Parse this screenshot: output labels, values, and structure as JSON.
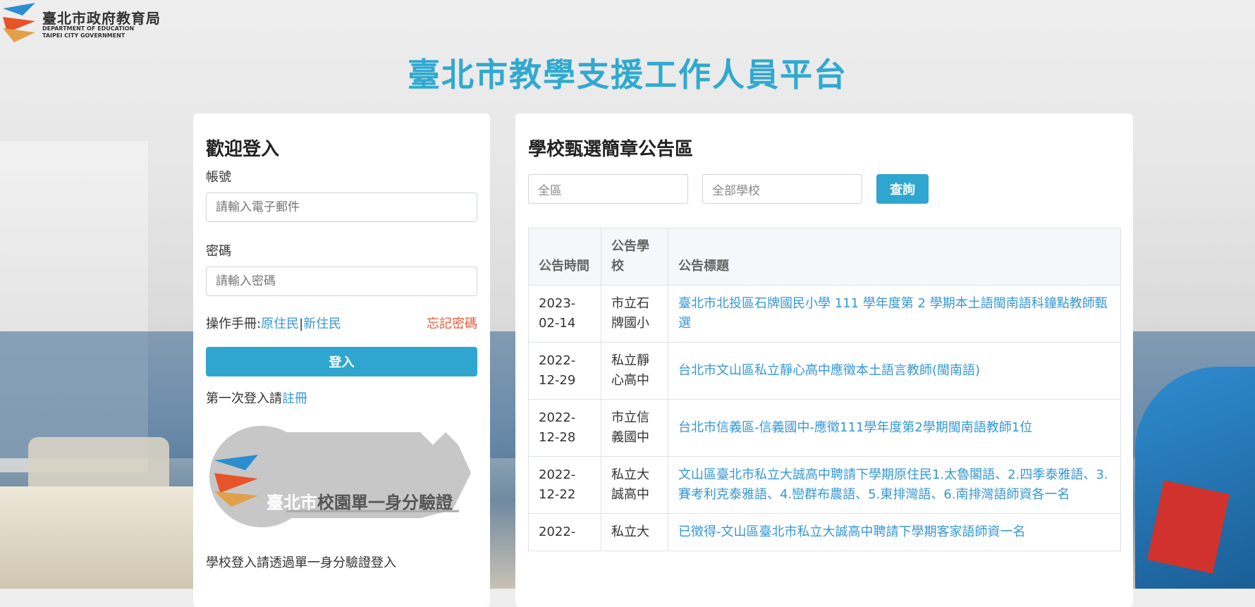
{
  "header": {
    "logo_cn": "臺北市政府教育局",
    "logo_en_line1": "DEPARTMENT OF EDUCATION",
    "logo_en_line2": "TAIPEI CITY GOVERNMENT",
    "site_title": "臺北市教學支援工作人員平台"
  },
  "login": {
    "heading": "歡迎登入",
    "account_label": "帳號",
    "account_placeholder": "請輸入電子郵件",
    "password_label": "密碼",
    "password_placeholder": "請輸入密碼",
    "manual_prefix": "操作手冊:",
    "manual_link1": "原住民",
    "manual_sep": "|",
    "manual_link2": "新住民",
    "forgot_password": "忘記密碼",
    "login_button": "登入",
    "first_login_prefix": "第一次登入請",
    "register_link": "註冊",
    "sso_text_prefix": "臺北市",
    "sso_text_suffix": "校園單一身分驗證",
    "school_login_note": "學校登入請透過單一身分驗證登入"
  },
  "news": {
    "heading": "學校甄選簡章公告區",
    "region_value": "全區",
    "school_value": "全部學校",
    "query_button": "查詢",
    "columns": [
      "公告時間",
      "公告學校",
      "公告標題"
    ],
    "rows": [
      {
        "date": "2023-02-14",
        "school": "市立石牌國小",
        "title": "臺北市北投區石牌國民小學 111 學年度第 2 學期本土語閩南語科鐘點教師甄選"
      },
      {
        "date": "2022-12-29",
        "school": "私立靜心高中",
        "title": "台北市文山區私立靜心高中應徵本土語言教師(閩南語)"
      },
      {
        "date": "2022-12-28",
        "school": "市立信義國中",
        "title": "台北市信義區-信義國中-應徵111學年度第2學期閩南語教師1位"
      },
      {
        "date": "2022-12-22",
        "school": "私立大誠高中",
        "title": "文山區臺北市私立大誠高中聘請下學期原住民1.太魯閣語、2.四季泰雅語、3.賽考利克泰雅語、4.巒群布農語、5.東排灣語、6.南排灣語師資各一名"
      },
      {
        "date": "2022-",
        "school": "私立大",
        "title": "已徵得-文山區臺北市私立大誠高中聘請下學期客家語師資一名"
      }
    ]
  },
  "colors": {
    "accent": "#2fa6cf",
    "title": "#31a9cf",
    "link": "#3597d3",
    "forgot": "#e05b3b"
  }
}
